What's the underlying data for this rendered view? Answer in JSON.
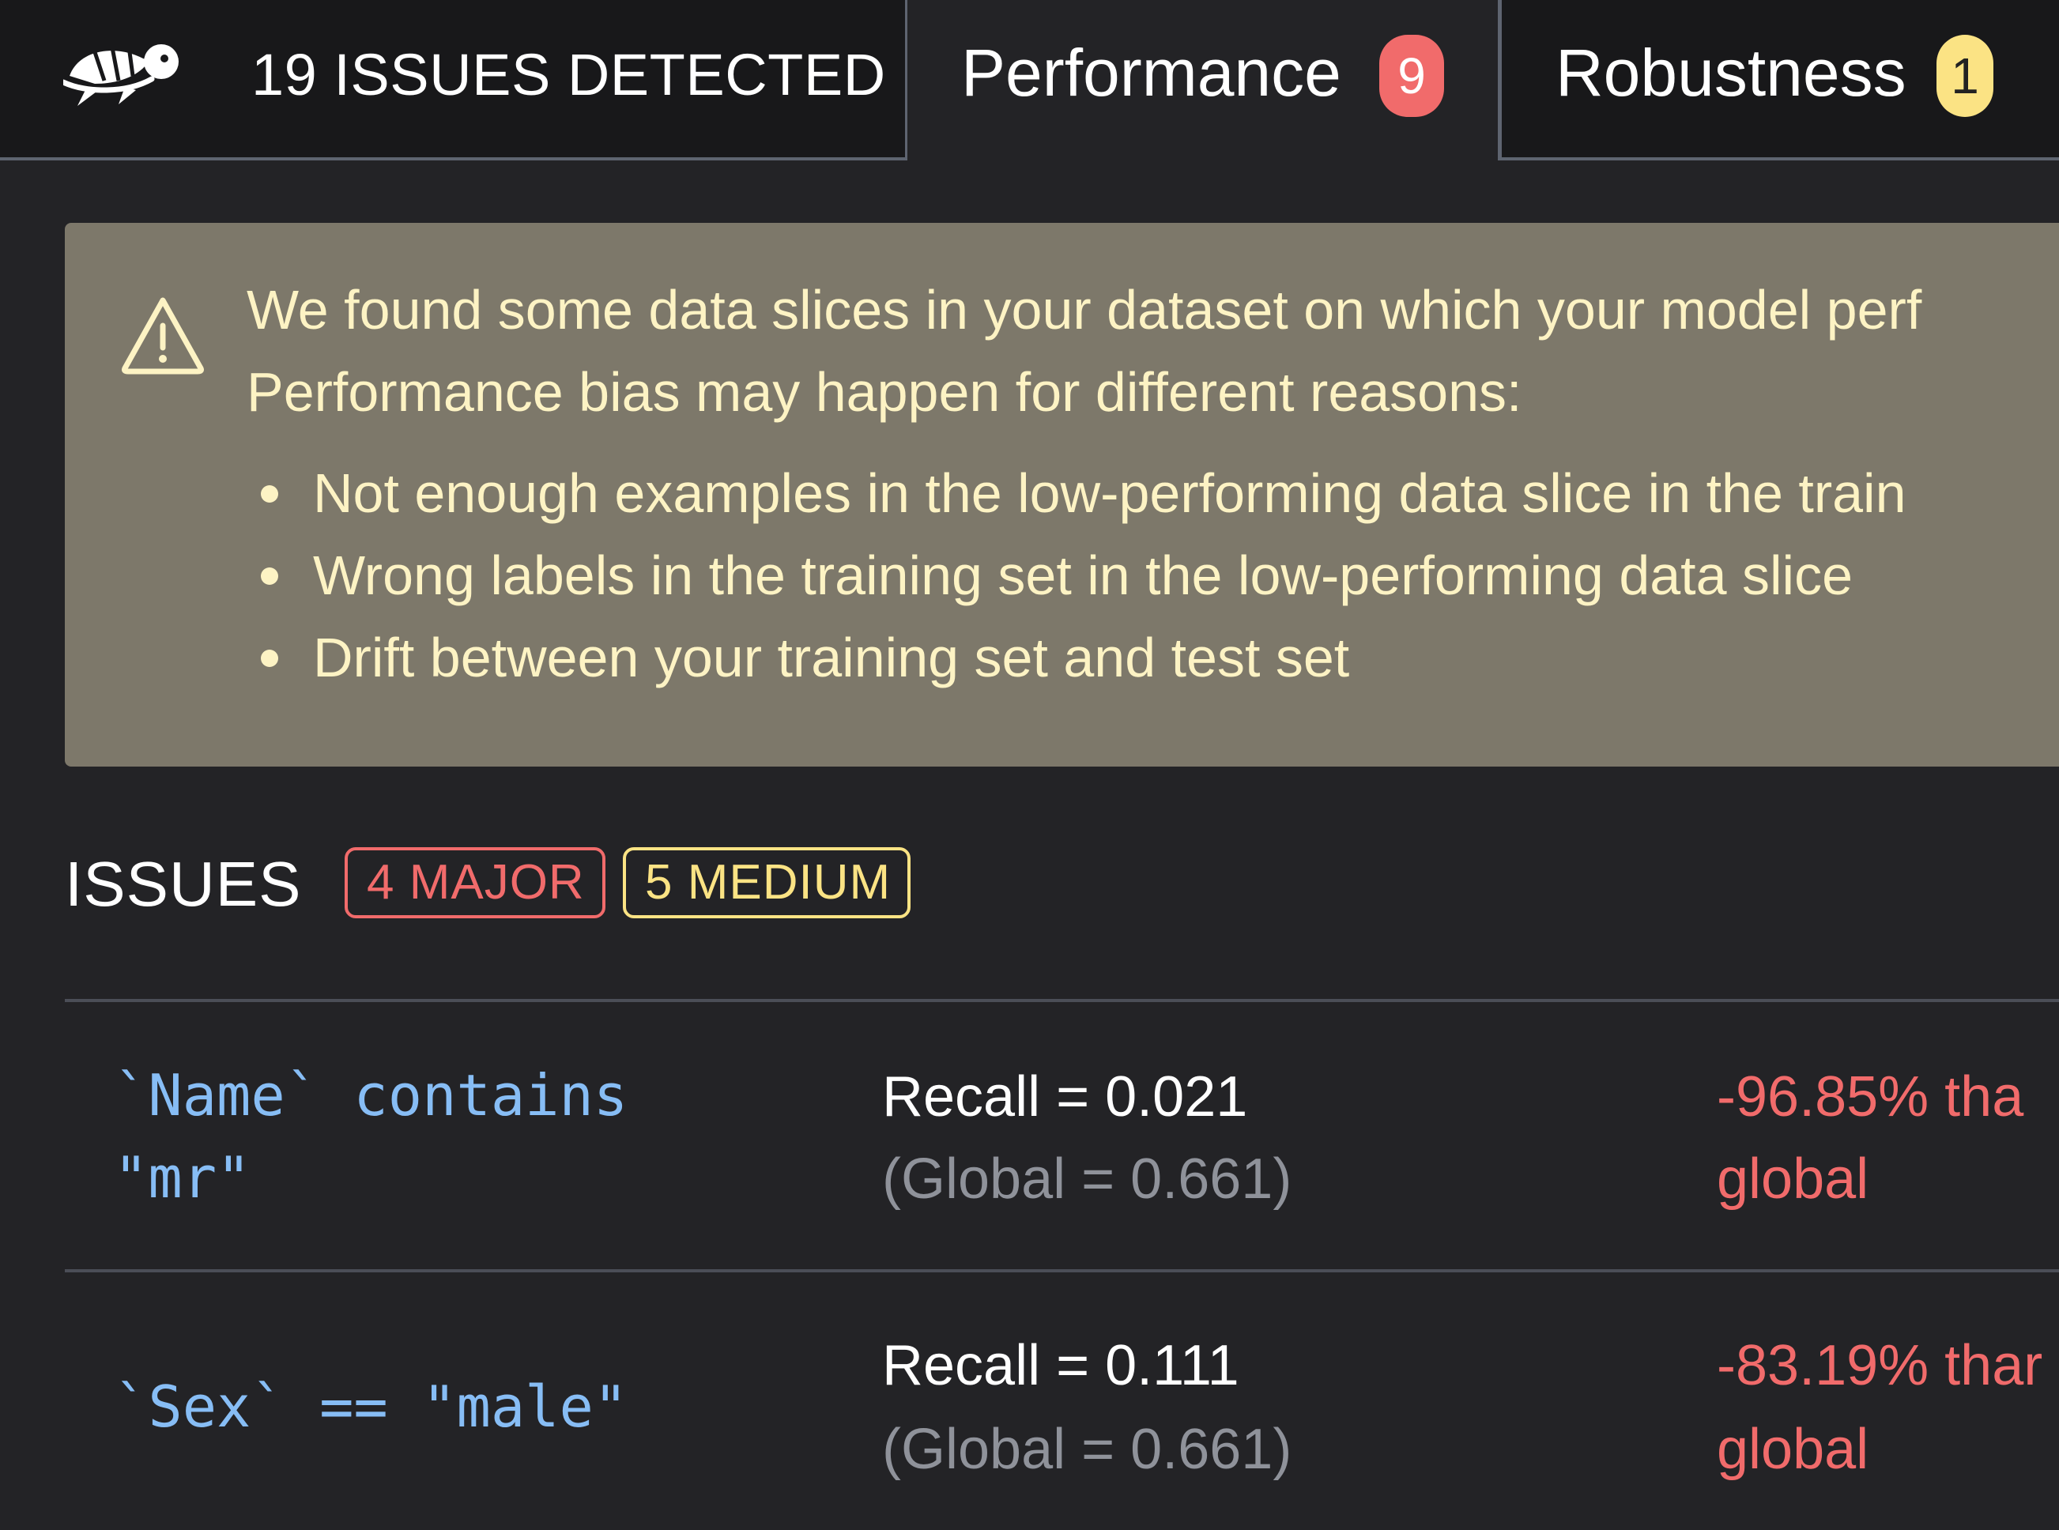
{
  "tabs": {
    "home": {
      "issues_detected_label": "19 ISSUES DETECTED",
      "logo_icon": "turtle-logo-icon"
    },
    "items": [
      {
        "label": "Performance",
        "badge": "9",
        "badge_color": "#f16b6b",
        "active": true
      },
      {
        "label": "Robustness",
        "badge": "1",
        "badge_color": "#fbe384",
        "active": false
      }
    ]
  },
  "info_panel": {
    "icon": "warning-triangle-icon",
    "background_color": "#7d786a",
    "text_color": "#fdf3c4",
    "line1": "We found some data slices in your dataset on which your model perf",
    "line2": "Performance bias may happen for different reasons:",
    "bullets": [
      "Not enough examples in the low-performing data slice in the train",
      "Wrong labels in the training set in the low-performing data slice",
      "Drift between your training set and test set"
    ]
  },
  "issues_header": {
    "title": "ISSUES",
    "major_label": "4 MAJOR",
    "medium_label": "5 MEDIUM",
    "major_color": "#f16b6b",
    "medium_color": "#fbe384"
  },
  "issues": [
    {
      "slice_line1": "`Name` contains",
      "slice_line2": "\"mr\"",
      "metric": "Recall = 0.021",
      "global": "(Global = 0.661)",
      "delta_line1": "-96.85% tha",
      "delta_line2": "global"
    },
    {
      "slice_line1": "`Sex` == \"male\"",
      "metric": "Recall = 0.111",
      "global": "(Global = 0.661)",
      "delta_line1": "-83.19% thar",
      "delta_line2": "global"
    }
  ]
}
